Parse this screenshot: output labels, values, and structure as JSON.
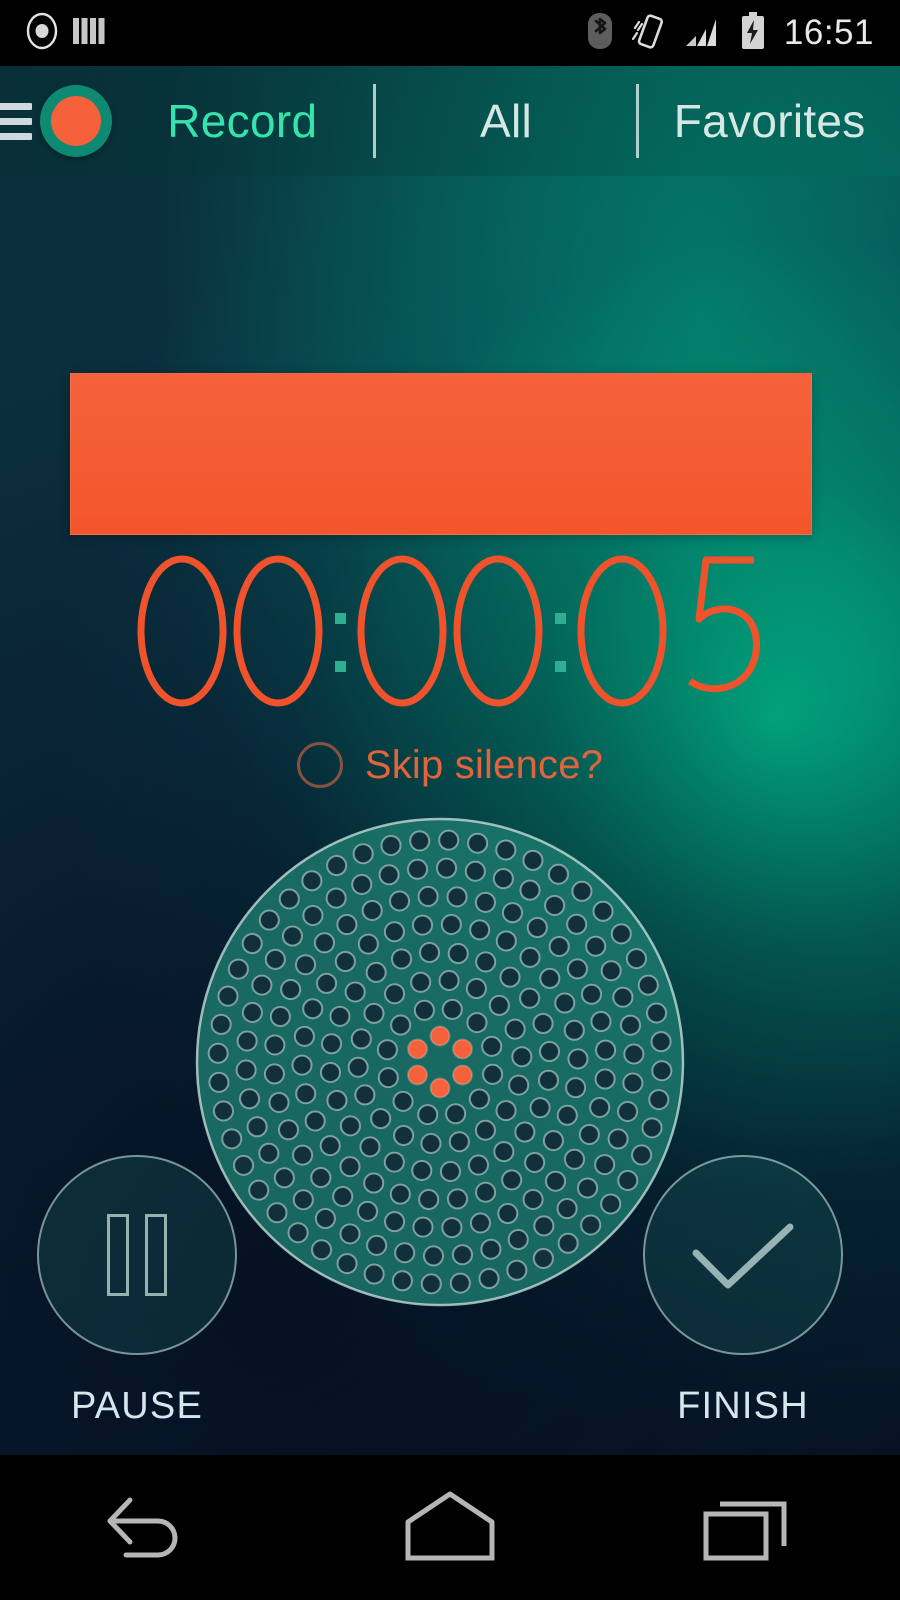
{
  "statusbar": {
    "time": "16:51",
    "left_icons": [
      {
        "name": "record-indicator-icon"
      },
      {
        "name": "equalizer-icon"
      }
    ],
    "right_icons": [
      {
        "name": "bluetooth-icon"
      },
      {
        "name": "vibrate-mode-icon"
      },
      {
        "name": "signal-bars-icon"
      },
      {
        "name": "battery-charging-icon"
      }
    ]
  },
  "actionbar": {
    "menu_icon": "hamburger-menu-icon",
    "logo_icon": "app-logo-record-icon",
    "tabs": [
      {
        "label": "Record",
        "active": true
      },
      {
        "label": "All",
        "active": false
      },
      {
        "label": "Favorites",
        "active": false
      }
    ]
  },
  "recorder": {
    "level_meter": {
      "name": "audio-level-bar",
      "fill_percent": 100,
      "color": "#f4613a"
    },
    "timer": {
      "value": "00:00:05",
      "hours": "00",
      "minutes": "00",
      "seconds": "05",
      "color": "#f0532b",
      "separator_color": "#2fae92"
    },
    "skip_silence": {
      "label": "Skip silence?",
      "checked": false,
      "color": "#e2633c"
    },
    "microphone": {
      "name": "microphone-grille",
      "active_dots": 6,
      "active_color": "#f4613a",
      "ring_color": "#cfe4e0",
      "fill_color": "#1d7a6e"
    }
  },
  "controls": [
    {
      "label": "PAUSE",
      "icon": "pause-icon"
    },
    {
      "label": "FINISH",
      "icon": "check-icon"
    }
  ],
  "navbar": [
    {
      "name": "back-button",
      "icon": "back-arrow-icon"
    },
    {
      "name": "home-button",
      "icon": "home-icon"
    },
    {
      "name": "recents-button",
      "icon": "recents-icon"
    }
  ],
  "theme": {
    "accent_orange": "#f4613a",
    "accent_teal": "#35e3ac",
    "bg_dark": "#07182a",
    "bg_teal": "#00a884"
  }
}
